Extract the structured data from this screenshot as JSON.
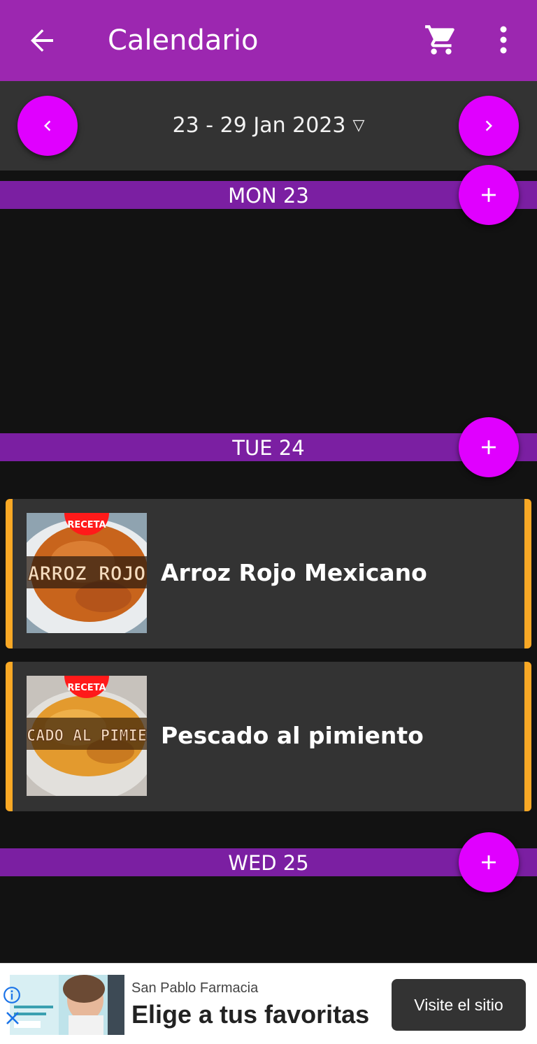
{
  "app": {
    "title": "Calendario",
    "icons": {
      "back": "arrow-back-icon",
      "cart": "shopping-cart-icon",
      "more": "more-vert-icon"
    },
    "colors": {
      "appbar": "#9c27b0",
      "day_header": "#7b1fa2",
      "fab": "#e000ff",
      "card_accent": "#f9a825"
    }
  },
  "week": {
    "range": "23 - 29 Jan 2023",
    "dropdown_glyph": "▽"
  },
  "days": [
    {
      "label": "MON 23",
      "meals": []
    },
    {
      "label": "TUE 24",
      "meals": [
        {
          "name": "Arroz Rojo Mexicano",
          "badge": "RECETA",
          "banner": "ARROZ ROJO"
        },
        {
          "name": "Pescado al pimiento",
          "badge": "RECETA",
          "banner": "PESCADO AL PIMIENTO"
        }
      ]
    },
    {
      "label": "WED 25",
      "meals": []
    }
  ],
  "ad": {
    "advertiser": "San Pablo Farmacia",
    "headline": "Elige a tus favoritas",
    "cta": "Visite el sitio"
  }
}
